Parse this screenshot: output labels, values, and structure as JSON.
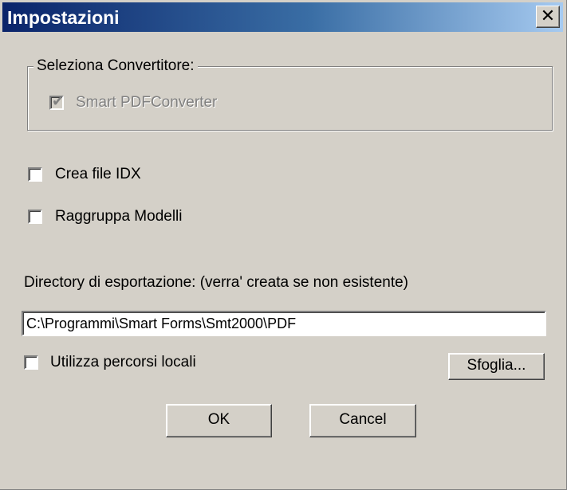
{
  "window": {
    "title": "Impostazioni",
    "close_glyph": "✕"
  },
  "converter_group": {
    "label": "Seleziona Convertitore:",
    "smart_pdf": {
      "label": "Smart PDFConverter",
      "checked": true,
      "disabled": true
    }
  },
  "options": {
    "crea_idx": {
      "label": "Crea file IDX",
      "checked": false
    },
    "raggruppa": {
      "label": "Raggruppa Modelli",
      "checked": false
    }
  },
  "export": {
    "label": "Directory di esportazione: (verra' creata se non esistente)",
    "path_value": "C:\\Programmi\\Smart Forms\\Smt2000\\PDF",
    "local_paths": {
      "label": "Utilizza percorsi locali",
      "checked": false
    },
    "browse_label": "Sfoglia..."
  },
  "buttons": {
    "ok_label": "OK",
    "cancel_label": "Cancel"
  },
  "colors": {
    "dialog_bg": "#d4d0c8",
    "title_start": "#0a246a",
    "title_end": "#a6caf0"
  }
}
